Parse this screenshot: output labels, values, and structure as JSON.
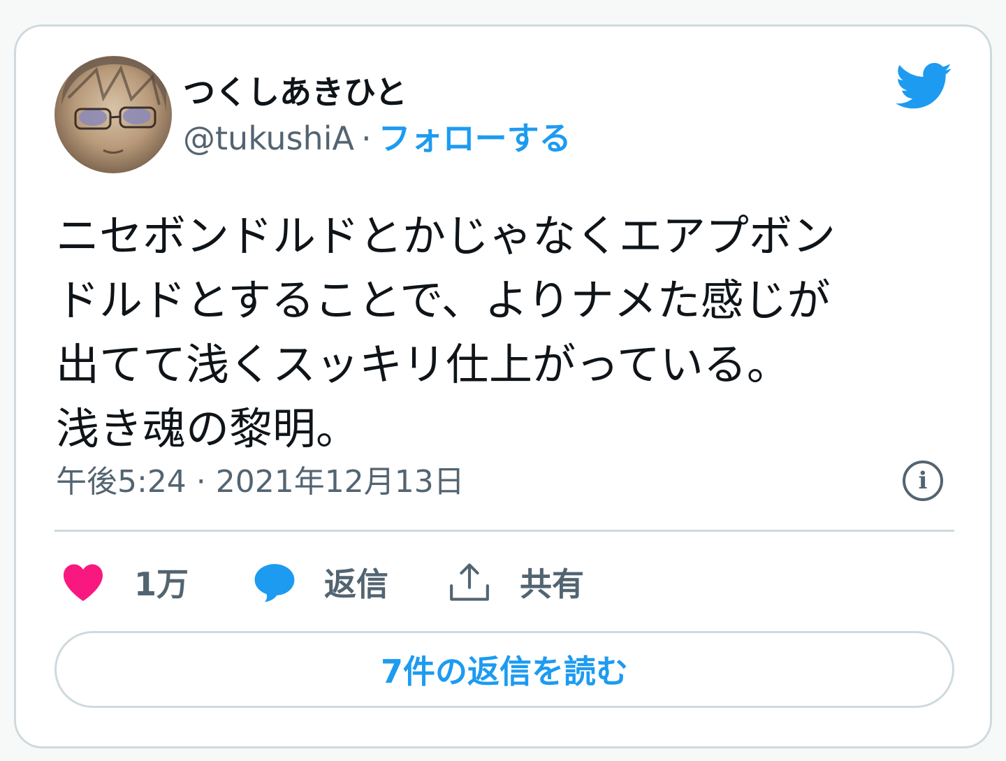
{
  "user": {
    "display_name": "つくしあきひと",
    "handle": "@tukushiA",
    "separator": "·",
    "follow_label": "フォローする"
  },
  "tweet": {
    "text": "ニセボンドルドとかじゃなくエアプボン\nドルドとすることで、よりナメた感じが\n出てて浅くスッキリ仕上がっている。\n浅き魂の黎明。",
    "time": "午後5:24",
    "date": "2021年12月13日",
    "meta_separator": " · "
  },
  "actions": {
    "like_count": "1万",
    "reply_label": "返信",
    "share_label": "共有"
  },
  "read_replies_label": "7件の返信を読む",
  "icons": {
    "bird": "twitter-bird-icon",
    "info": "info-icon",
    "like": "heart-icon",
    "reply": "reply-bubble-icon",
    "share": "share-icon"
  },
  "colors": {
    "accent": "#1d9bf0",
    "like": "#f91880",
    "muted": "#536471",
    "text": "#0f1419",
    "border": "#cfd9de"
  }
}
